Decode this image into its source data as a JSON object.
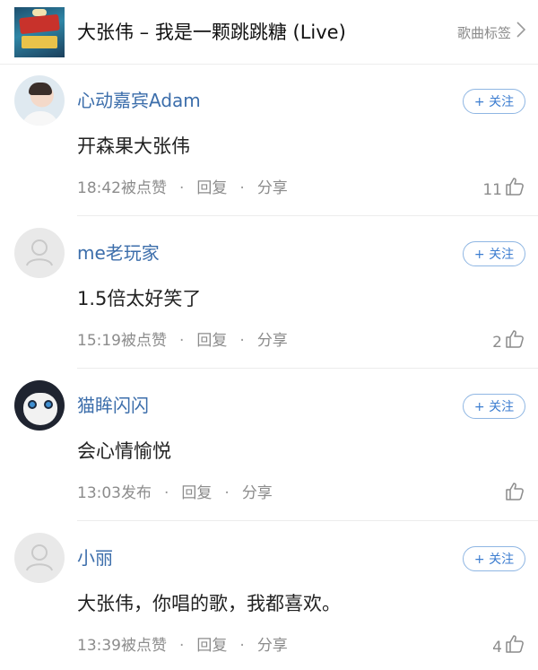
{
  "header": {
    "song_title": "大张伟 – 我是一颗跳跳糖 (Live)",
    "tag_link": "歌曲标签",
    "tag_chevron": "›"
  },
  "follow_label": "+ 关注",
  "actions": {
    "reply": "回复",
    "share": "分享",
    "separator": "·"
  },
  "comments": [
    {
      "username": "心动嘉宾Adam",
      "content": "开森果大张伟",
      "time": "18:42被点赞",
      "likes": "11",
      "avatar": "photo"
    },
    {
      "username": "me老玩家",
      "content": "1.5倍太好笑了",
      "time": "15:19被点赞",
      "likes": "2",
      "avatar": "default"
    },
    {
      "username": "猫眸闪闪",
      "content": "会心情愉悦",
      "time": "13:03发布",
      "likes": "",
      "avatar": "photo"
    },
    {
      "username": "小丽",
      "content": "大张伟，你唱的歌，我都喜欢。",
      "time": "13:39被点赞",
      "likes": "4",
      "avatar": "default"
    }
  ],
  "colors": {
    "username": "#3c6eab",
    "follow_border": "#8fb6e3",
    "follow_text": "#3c7dd0",
    "meta_text": "#8c8c8c"
  }
}
